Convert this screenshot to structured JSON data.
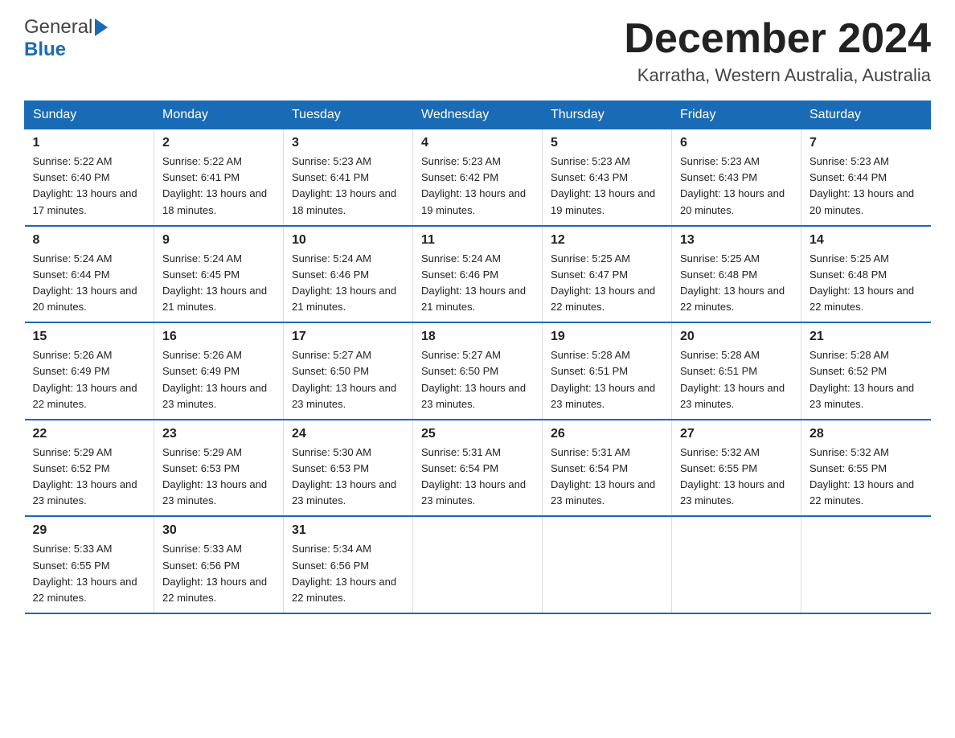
{
  "header": {
    "logo_general": "General",
    "logo_blue": "Blue",
    "month_title": "December 2024",
    "location": "Karratha, Western Australia, Australia"
  },
  "weekdays": [
    "Sunday",
    "Monday",
    "Tuesday",
    "Wednesday",
    "Thursday",
    "Friday",
    "Saturday"
  ],
  "weeks": [
    [
      {
        "day": "1",
        "sunrise": "5:22 AM",
        "sunset": "6:40 PM",
        "daylight": "13 hours and 17 minutes."
      },
      {
        "day": "2",
        "sunrise": "5:22 AM",
        "sunset": "6:41 PM",
        "daylight": "13 hours and 18 minutes."
      },
      {
        "day": "3",
        "sunrise": "5:23 AM",
        "sunset": "6:41 PM",
        "daylight": "13 hours and 18 minutes."
      },
      {
        "day": "4",
        "sunrise": "5:23 AM",
        "sunset": "6:42 PM",
        "daylight": "13 hours and 19 minutes."
      },
      {
        "day": "5",
        "sunrise": "5:23 AM",
        "sunset": "6:43 PM",
        "daylight": "13 hours and 19 minutes."
      },
      {
        "day": "6",
        "sunrise": "5:23 AM",
        "sunset": "6:43 PM",
        "daylight": "13 hours and 20 minutes."
      },
      {
        "day": "7",
        "sunrise": "5:23 AM",
        "sunset": "6:44 PM",
        "daylight": "13 hours and 20 minutes."
      }
    ],
    [
      {
        "day": "8",
        "sunrise": "5:24 AM",
        "sunset": "6:44 PM",
        "daylight": "13 hours and 20 minutes."
      },
      {
        "day": "9",
        "sunrise": "5:24 AM",
        "sunset": "6:45 PM",
        "daylight": "13 hours and 21 minutes."
      },
      {
        "day": "10",
        "sunrise": "5:24 AM",
        "sunset": "6:46 PM",
        "daylight": "13 hours and 21 minutes."
      },
      {
        "day": "11",
        "sunrise": "5:24 AM",
        "sunset": "6:46 PM",
        "daylight": "13 hours and 21 minutes."
      },
      {
        "day": "12",
        "sunrise": "5:25 AM",
        "sunset": "6:47 PM",
        "daylight": "13 hours and 22 minutes."
      },
      {
        "day": "13",
        "sunrise": "5:25 AM",
        "sunset": "6:48 PM",
        "daylight": "13 hours and 22 minutes."
      },
      {
        "day": "14",
        "sunrise": "5:25 AM",
        "sunset": "6:48 PM",
        "daylight": "13 hours and 22 minutes."
      }
    ],
    [
      {
        "day": "15",
        "sunrise": "5:26 AM",
        "sunset": "6:49 PM",
        "daylight": "13 hours and 22 minutes."
      },
      {
        "day": "16",
        "sunrise": "5:26 AM",
        "sunset": "6:49 PM",
        "daylight": "13 hours and 23 minutes."
      },
      {
        "day": "17",
        "sunrise": "5:27 AM",
        "sunset": "6:50 PM",
        "daylight": "13 hours and 23 minutes."
      },
      {
        "day": "18",
        "sunrise": "5:27 AM",
        "sunset": "6:50 PM",
        "daylight": "13 hours and 23 minutes."
      },
      {
        "day": "19",
        "sunrise": "5:28 AM",
        "sunset": "6:51 PM",
        "daylight": "13 hours and 23 minutes."
      },
      {
        "day": "20",
        "sunrise": "5:28 AM",
        "sunset": "6:51 PM",
        "daylight": "13 hours and 23 minutes."
      },
      {
        "day": "21",
        "sunrise": "5:28 AM",
        "sunset": "6:52 PM",
        "daylight": "13 hours and 23 minutes."
      }
    ],
    [
      {
        "day": "22",
        "sunrise": "5:29 AM",
        "sunset": "6:52 PM",
        "daylight": "13 hours and 23 minutes."
      },
      {
        "day": "23",
        "sunrise": "5:29 AM",
        "sunset": "6:53 PM",
        "daylight": "13 hours and 23 minutes."
      },
      {
        "day": "24",
        "sunrise": "5:30 AM",
        "sunset": "6:53 PM",
        "daylight": "13 hours and 23 minutes."
      },
      {
        "day": "25",
        "sunrise": "5:31 AM",
        "sunset": "6:54 PM",
        "daylight": "13 hours and 23 minutes."
      },
      {
        "day": "26",
        "sunrise": "5:31 AM",
        "sunset": "6:54 PM",
        "daylight": "13 hours and 23 minutes."
      },
      {
        "day": "27",
        "sunrise": "5:32 AM",
        "sunset": "6:55 PM",
        "daylight": "13 hours and 23 minutes."
      },
      {
        "day": "28",
        "sunrise": "5:32 AM",
        "sunset": "6:55 PM",
        "daylight": "13 hours and 22 minutes."
      }
    ],
    [
      {
        "day": "29",
        "sunrise": "5:33 AM",
        "sunset": "6:55 PM",
        "daylight": "13 hours and 22 minutes."
      },
      {
        "day": "30",
        "sunrise": "5:33 AM",
        "sunset": "6:56 PM",
        "daylight": "13 hours and 22 minutes."
      },
      {
        "day": "31",
        "sunrise": "5:34 AM",
        "sunset": "6:56 PM",
        "daylight": "13 hours and 22 minutes."
      },
      null,
      null,
      null,
      null
    ]
  ]
}
